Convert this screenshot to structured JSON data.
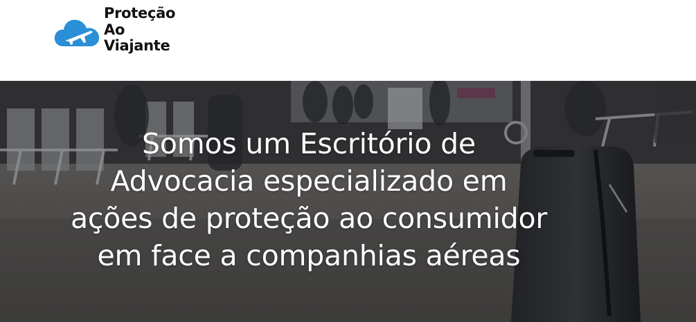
{
  "brand": {
    "name_lines": [
      "Proteção",
      "Ao",
      "Viajante"
    ],
    "logo_icon": "cloud-airplane-icon",
    "logo_color": "#2a8fd6"
  },
  "hero": {
    "title_lines": [
      "Somos um Escritório de",
      "Advocacia especializado em",
      "ações de proteção ao consumidor",
      "em face a companhias aéreas"
    ],
    "background_image": "airport-terminal-suitcase-photo"
  },
  "colors": {
    "header_bg": "#ffffff",
    "hero_text": "#ffffff",
    "logo_blue": "#2a8fd6"
  }
}
